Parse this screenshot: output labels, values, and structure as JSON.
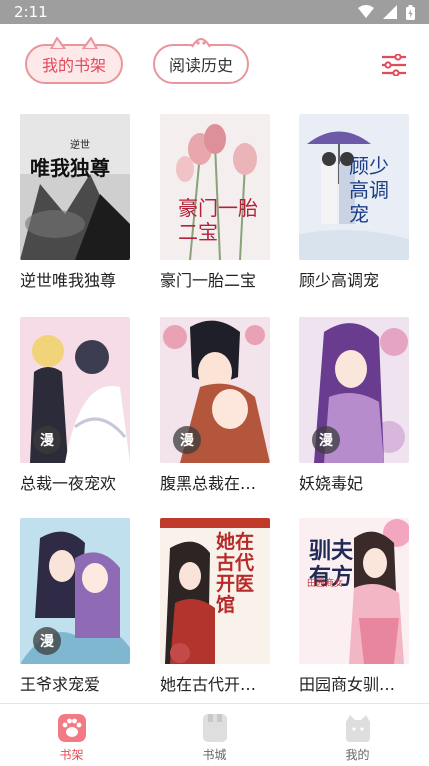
{
  "status_bar": {
    "time": "2:11"
  },
  "header": {
    "tab_bookshelf": "我的书架",
    "tab_history": "阅读历史"
  },
  "books": [
    {
      "title": "逆世唯我独尊",
      "cover_text": "唯我独尊",
      "cover_small": "逆世",
      "comic": false
    },
    {
      "title": "豪门一胎二宝",
      "cover_text": "豪门一胎二宝",
      "comic": false
    },
    {
      "title": "顾少高调宠",
      "cover_text": "顾少高调宠",
      "comic": false
    },
    {
      "title": "总裁一夜宠欢",
      "comic": true
    },
    {
      "title": "腹黑总裁在…",
      "comic": true
    },
    {
      "title": "妖娆毒妃",
      "comic": true
    },
    {
      "title": "王爷求宠爱",
      "comic": true
    },
    {
      "title": "她在古代开…",
      "cover_text": "她在古代开医馆",
      "comic": false
    },
    {
      "title": "田园商女驯…",
      "cover_text": "驯夫有方",
      "cover_small": "田园商女",
      "comic": false
    }
  ],
  "comic_badge": "漫",
  "tabbar": {
    "bookshelf": "书架",
    "store": "书城",
    "mine": "我的"
  },
  "colors": {
    "accent": "#e24a5a",
    "pill_border": "#e8969b",
    "status_bar": "#9e9e9e"
  }
}
